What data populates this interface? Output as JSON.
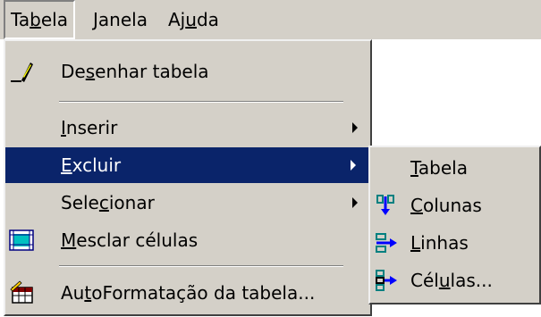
{
  "menubar": {
    "items": [
      {
        "label": "Tabela",
        "mnemonic_index": 2
      },
      {
        "label": "Janela",
        "mnemonic_index": 0
      },
      {
        "label": "Ajuda",
        "mnemonic_index": 2
      }
    ]
  },
  "tabela_menu": {
    "items": [
      {
        "label": "Desenhar tabela",
        "mnemonic_index": 2,
        "icon": "pencil-icon",
        "has_submenu": false,
        "highlighted": false
      },
      {
        "label": "Inserir",
        "mnemonic_index": 0,
        "icon": null,
        "has_submenu": true,
        "highlighted": false
      },
      {
        "label": "Excluir",
        "mnemonic_index": 0,
        "icon": null,
        "has_submenu": true,
        "highlighted": true
      },
      {
        "label": "Selecionar",
        "mnemonic_index": 4,
        "icon": null,
        "has_submenu": true,
        "highlighted": false
      },
      {
        "label": "Mesclar células",
        "mnemonic_index": 0,
        "icon": "merge-cells-icon",
        "has_submenu": false,
        "highlighted": false
      },
      {
        "label": "AutoFormatação da tabela...",
        "mnemonic_index": 2,
        "icon": "autoformat-table-icon",
        "has_submenu": false,
        "highlighted": false
      }
    ]
  },
  "excluir_submenu": {
    "items": [
      {
        "label": "Tabela",
        "mnemonic_index": 0,
        "icon": null
      },
      {
        "label": "Colunas",
        "mnemonic_index": 0,
        "icon": "delete-columns-icon"
      },
      {
        "label": "Linhas",
        "mnemonic_index": 0,
        "icon": "delete-rows-icon"
      },
      {
        "label": "Células...",
        "mnemonic_index": 3,
        "icon": "delete-cells-icon"
      }
    ]
  },
  "colors": {
    "menu_bg": "#d4d0c8",
    "highlight": "#0a246a",
    "icon_teal": "#008080",
    "icon_blue": "#0000ff",
    "icon_yellow": "#ffff00",
    "icon_red": "#ff0000"
  }
}
